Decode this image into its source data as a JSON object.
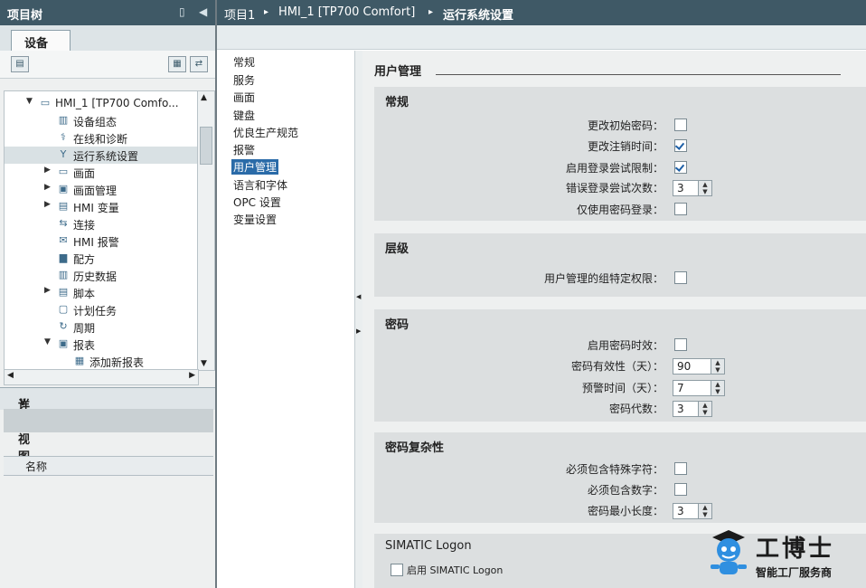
{
  "project_tree": {
    "title": "项目树",
    "tab": "设备",
    "items": [
      {
        "label": "HMI_1 [TP700 Comfo...",
        "icon": "hmi-device-icon"
      },
      {
        "label": "设备组态",
        "icon": "device-config-icon"
      },
      {
        "label": "在线和诊断",
        "icon": "online-diagnostics-icon"
      },
      {
        "label": "运行系统设置",
        "icon": "runtime-settings-icon"
      },
      {
        "label": "画面",
        "icon": "folder-screens-icon"
      },
      {
        "label": "画面管理",
        "icon": "screen-management-icon"
      },
      {
        "label": "HMI 变量",
        "icon": "hmi-tags-icon"
      },
      {
        "label": "连接",
        "icon": "connections-icon"
      },
      {
        "label": "HMI 报警",
        "icon": "hmi-alarms-icon"
      },
      {
        "label": "配方",
        "icon": "recipes-icon"
      },
      {
        "label": "历史数据",
        "icon": "historical-data-icon"
      },
      {
        "label": "脚本",
        "icon": "scripts-icon"
      },
      {
        "label": "计划任务",
        "icon": "scheduled-tasks-icon"
      },
      {
        "label": "周期",
        "icon": "cycles-icon"
      },
      {
        "label": "报表",
        "icon": "reports-icon"
      },
      {
        "label": "添加新报表",
        "icon": "add-report-icon"
      }
    ]
  },
  "detail_view": {
    "title": "详细视图",
    "column_name": "名称"
  },
  "breadcrumb": {
    "project": "项目1",
    "device": "HMI_1 [TP700 Comfort]",
    "page": "运行系统设置",
    "separator": "▸"
  },
  "nav": {
    "items": [
      "常规",
      "服务",
      "画面",
      "键盘",
      "优良生产规范",
      "报警",
      "用户管理",
      "语言和字体",
      "OPC 设置",
      "变量设置"
    ],
    "active": "用户管理"
  },
  "content": {
    "title": "用户管理",
    "groups": {
      "general": {
        "title": "常规",
        "props": {
          "change_initial_password": {
            "label": "更改初始密码：",
            "checked": false
          },
          "change_logoff_time": {
            "label": "更改注销时间：",
            "checked": true
          },
          "enable_login_limit": {
            "label": "启用登录尝试限制：",
            "checked": true
          },
          "failed_login_count": {
            "label": "错误登录尝试次数：",
            "value": "3"
          },
          "password_only_login": {
            "label": "仅使用密码登录：",
            "checked": false
          }
        }
      },
      "hierarchy": {
        "title": "层级",
        "props": {
          "group_specific_rights": {
            "label": "用户管理的组特定权限：",
            "checked": false
          }
        }
      },
      "password": {
        "title": "密码",
        "props": {
          "enable_password_expiry": {
            "label": "启用密码时效：",
            "checked": false
          },
          "password_validity": {
            "label": "密码有效性（天）：",
            "value": "90"
          },
          "prewarning_time": {
            "label": "预警时间（天）：",
            "value": "7"
          },
          "password_generations": {
            "label": "密码代数：",
            "value": "3"
          }
        }
      },
      "complexity": {
        "title": "密码复杂性",
        "props": {
          "special_char": {
            "label": "必须包含特殊字符：",
            "checked": false
          },
          "must_contain_digit": {
            "label": "必须包含数字：",
            "checked": false
          },
          "min_length": {
            "label": "密码最小长度：",
            "value": "3"
          }
        }
      },
      "simatic": {
        "title": "SIMATIC Logon",
        "enable_label": "启用 SIMATIC Logon",
        "checked": false
      }
    }
  },
  "watermark": {
    "brand": "工博士",
    "tagline": "智能工厂服务商"
  },
  "colors": {
    "title_bar": "#3f5966",
    "active_nav": "#2a6ba8",
    "group_bg": "#dcdfe0",
    "checkbox_check": "#1d5fa6"
  }
}
